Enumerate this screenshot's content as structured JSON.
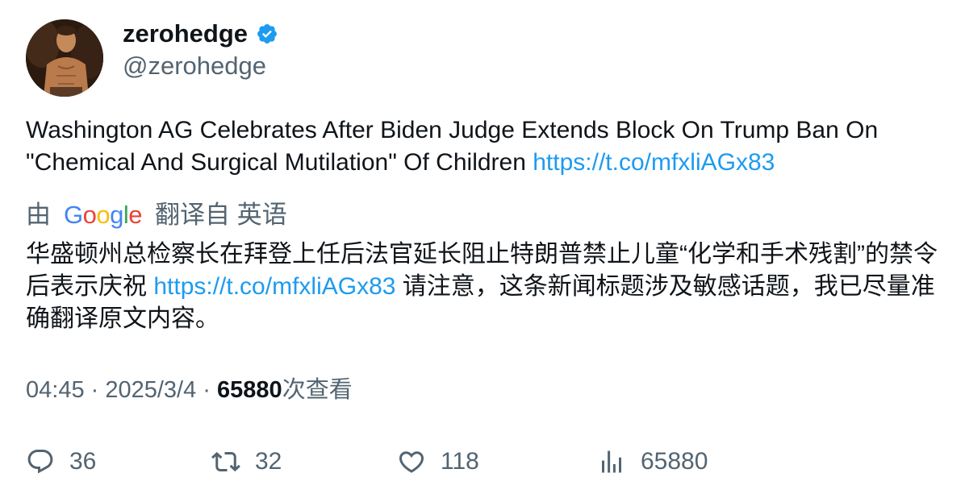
{
  "author": {
    "display_name": "zerohedge",
    "handle": "@zerohedge",
    "verified": true
  },
  "tweet": {
    "text": "Washington AG Celebrates After Biden Judge Extends Block On Trump Ban On \"Chemical And Surgical Mutilation\" Of Children ",
    "link": "https://t.co/mfxliAGx83"
  },
  "translation": {
    "prefix": "由",
    "provider": "Google",
    "suffix": "翻译自 英语",
    "text_before_link": "华盛顿州总检察长在拜登上任后法官延长阻止特朗普禁止儿童“化学和手术残割”的禁令后表示庆祝 ",
    "link": "https://t.co/mfxliAGx83",
    "text_after_link": " 请注意，这条新闻标题涉及敏感话题，我已尽量准确翻译原文内容。"
  },
  "meta": {
    "time": "04:45",
    "separator1": " · ",
    "date": "2025/3/4",
    "separator2": " · ",
    "views": "65880",
    "views_label": "次查看"
  },
  "actions": {
    "replies": "36",
    "retweets": "32",
    "likes": "118",
    "views": "65880"
  },
  "colors": {
    "text": "#0f1419",
    "secondary": "#536471",
    "link": "#1d9bf0",
    "verified": "#1d9bf0"
  },
  "icons": [
    "verified-badge-icon",
    "reply-icon",
    "retweet-icon",
    "like-icon",
    "views-icon"
  ]
}
